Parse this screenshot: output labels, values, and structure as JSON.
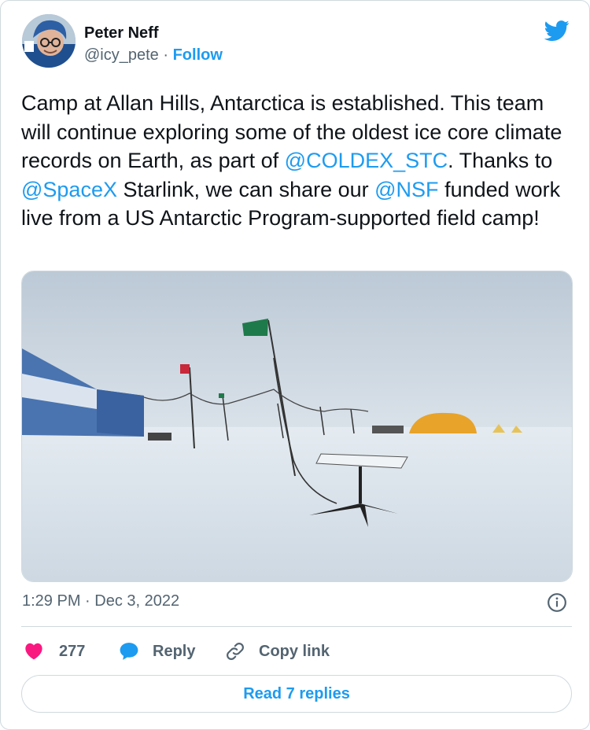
{
  "author": {
    "name": "Peter Neff",
    "handle": "@icy_pete",
    "separator": "·",
    "follow_label": "Follow"
  },
  "tweet": {
    "text_line1": "Camp at Allan Hills, Antarctica is established. This team will continue exploring some of the oldest ice core climate records on Earth, as part of ",
    "mention1": "@COLDEX_STC",
    "text_mid1": ". Thanks to ",
    "mention2": "@SpaceX",
    "text_mid2": " Starlink, we can share our ",
    "mention3": "@NSF",
    "text_end": " funded work live from a US Antarctic Program-supported field camp!"
  },
  "meta": {
    "timestamp": "1:29 PM · Dec 3, 2022"
  },
  "actions": {
    "like_count": "277",
    "reply_label": "Reply",
    "copy_label": "Copy link"
  },
  "footer": {
    "read_replies_label": "Read 7 replies"
  },
  "colors": {
    "accent": "#1d9bf0",
    "like": "#f91880",
    "muted": "#536471",
    "border": "#cfd9de"
  },
  "icons": [
    "twitter-bird-icon",
    "info-icon",
    "heart-icon",
    "reply-bubble-icon",
    "link-icon"
  ]
}
